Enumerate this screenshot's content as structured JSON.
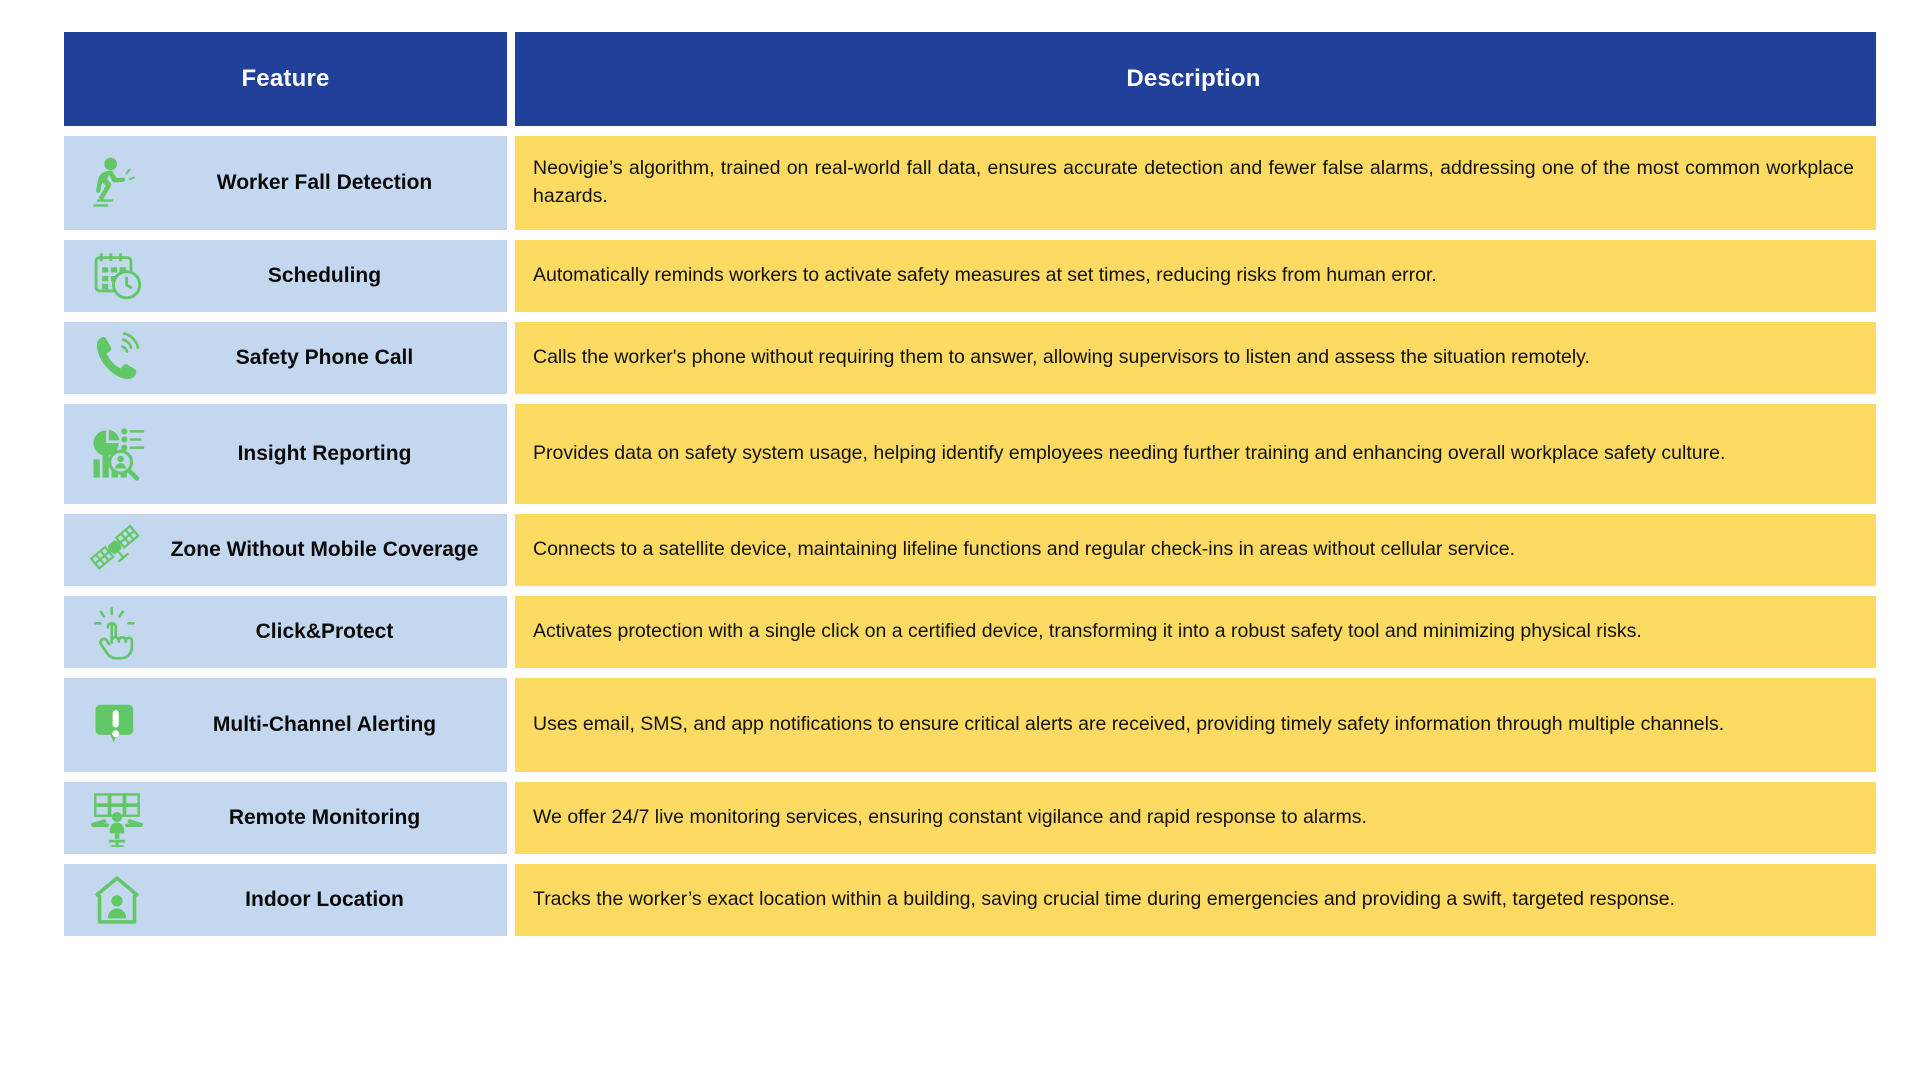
{
  "table": {
    "columns": [
      {
        "key": "feature",
        "label": "Feature"
      },
      {
        "key": "description",
        "label": "Description"
      }
    ],
    "colors": {
      "header_bg": "#21409A",
      "header_text": "#FFFFFF",
      "feature_bg": "#C3D7EE",
      "description_bg": "#FDDB63",
      "icon_green": "#62C766",
      "body_text": "#111111",
      "page_bg": "#FFFFFF"
    },
    "rows": [
      {
        "icon": "worker-fall-detection-icon",
        "feature": "Worker Fall Detection",
        "description": "Neovigie’s algorithm, trained on real-world fall data, ensures accurate detection and fewer false alarms, addressing one of the most common workplace hazards."
      },
      {
        "icon": "calendar-clock-icon",
        "feature": "Scheduling",
        "description": "Automatically reminds workers to activate safety measures at set times, reducing risks from human error."
      },
      {
        "icon": "phone-call-icon",
        "feature": "Safety Phone Call",
        "description": "Calls the worker's phone without requiring them to answer, allowing supervisors to listen and assess the situation remotely."
      },
      {
        "icon": "insight-reporting-chart-icon",
        "feature": "Insight Reporting",
        "description": "Provides data on safety system usage, helping identify employees needing further training and enhancing overall workplace safety culture."
      },
      {
        "icon": "satellite-icon",
        "feature": "Zone Without Mobile Coverage",
        "description": "Connects to a satellite device, maintaining lifeline functions and regular check-ins in areas without cellular service."
      },
      {
        "icon": "click-hand-icon",
        "feature": "Click&Protect",
        "description": "Activates protection with a single click on a certified device, transforming it into a robust safety tool and minimizing physical risks."
      },
      {
        "icon": "alert-bubble-icon",
        "feature": "Multi-Channel Alerting",
        "description": "Uses email, SMS, and app notifications to ensure critical alerts are received, providing timely safety information through multiple channels."
      },
      {
        "icon": "remote-monitoring-icon",
        "feature": "Remote Monitoring",
        "description": "We offer 24/7 live monitoring services, ensuring constant vigilance and rapid response to alarms."
      },
      {
        "icon": "indoor-location-house-icon",
        "feature": "Indoor Location",
        "description": "Tracks the worker’s exact location within a building, saving crucial time during emergencies and providing a swift, targeted response."
      }
    ]
  }
}
